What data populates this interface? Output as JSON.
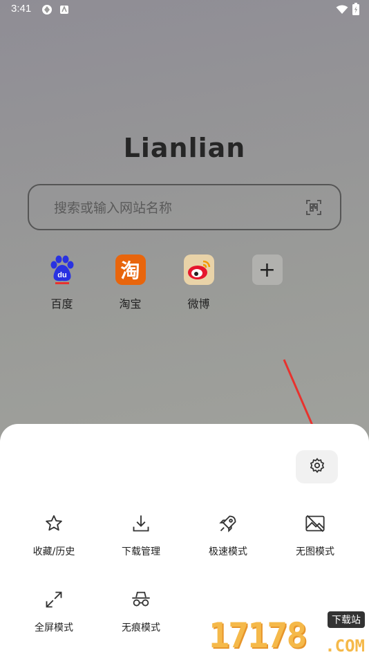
{
  "status_bar": {
    "time": "3:41"
  },
  "logo": "Lianlian",
  "search": {
    "placeholder": "搜索或输入网站名称"
  },
  "shortcuts": [
    {
      "label": "百度",
      "icon": "baidu-icon"
    },
    {
      "label": "淘宝",
      "icon": "taobao-icon",
      "glyph": "淘"
    },
    {
      "label": "微博",
      "icon": "weibo-icon"
    }
  ],
  "menu": {
    "items": [
      {
        "label": "收藏/历史",
        "icon": "star-icon"
      },
      {
        "label": "下载管理",
        "icon": "download-icon"
      },
      {
        "label": "极速模式",
        "icon": "rocket-icon"
      },
      {
        "label": "无图模式",
        "icon": "no-image-icon"
      },
      {
        "label": "全屏模式",
        "icon": "fullscreen-icon"
      },
      {
        "label": "无痕模式",
        "icon": "incognito-icon"
      }
    ]
  },
  "watermark": {
    "digits": "17178",
    "badge": "下载站",
    "domain": ".COM"
  },
  "colors": {
    "accent_red": "#e8322e",
    "taobao_orange": "#e8650c",
    "baidu_blue": "#2932e1"
  }
}
